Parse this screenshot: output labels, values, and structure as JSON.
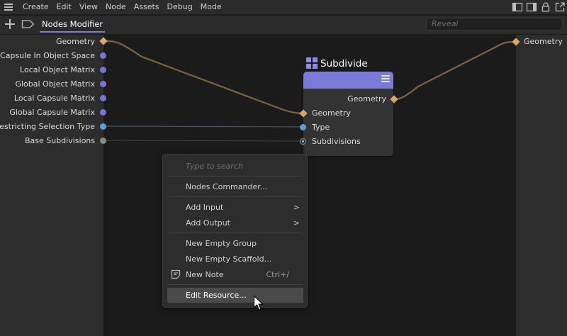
{
  "menu": {
    "items": [
      "Create",
      "Edit",
      "View",
      "Node",
      "Assets",
      "Debug",
      "Mode"
    ]
  },
  "tabbar": {
    "active_tab": "Nodes Modifier",
    "reveal_placeholder": "Reveal"
  },
  "left_ports": [
    {
      "label": "Geometry",
      "type": "geometry"
    },
    {
      "label": "Capsule In Object Space",
      "type": "violet"
    },
    {
      "label": "Local Object Matrix",
      "type": "violet"
    },
    {
      "label": "Global Object Matrix",
      "type": "violet"
    },
    {
      "label": "Local Capsule Matrix",
      "type": "violet"
    },
    {
      "label": "Global Capsule Matrix",
      "type": "violet"
    },
    {
      "label": "Restricting Selection Type",
      "type": "blue"
    },
    {
      "label": "Base Subdivisions",
      "type": "grey"
    }
  ],
  "right_port": {
    "label": "Geometry"
  },
  "node": {
    "title": "Subdivide",
    "output": "Geometry",
    "inputs": [
      "Geometry",
      "Type",
      "Subdivisions"
    ]
  },
  "context_menu": {
    "search_placeholder": "Type to search",
    "commander": "Nodes Commander...",
    "add_input": "Add Input",
    "add_output": "Add Output",
    "new_empty_group": "New Empty Group",
    "new_empty_scaffold": "New Empty Scaffold...",
    "new_note": "New Note",
    "new_note_shortcut": "Ctrl+/",
    "edit_resource": "Edit Resource...",
    "submenu_arrow": ">"
  },
  "colors": {
    "accent": "#7a7ad8",
    "geometry_wire": "#7f6340",
    "geometry_port": "#d7a86a",
    "violet_port": "#7676d6",
    "blue_port": "#5aa0d8"
  }
}
